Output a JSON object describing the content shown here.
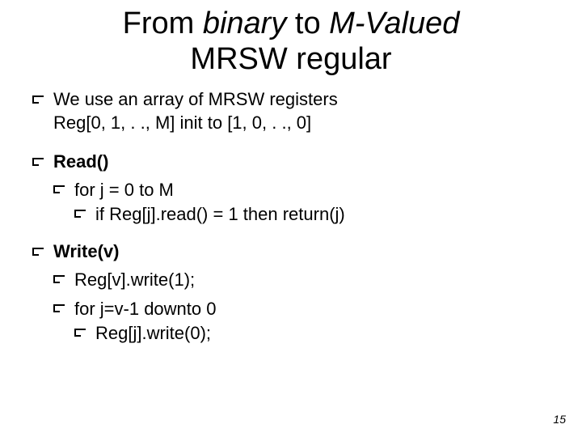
{
  "title": {
    "part1": "From ",
    "part2_ital": "binary",
    "part3": " to ",
    "part4_ital": "M-Valued",
    "line2": "MRSW regular"
  },
  "intro": {
    "line1": "We use an array of MRSW registers",
    "line2": "Reg[0, 1, . ., M] init to [1, 0, . ., 0]"
  },
  "read": {
    "header": "Read()",
    "l1": "for j = 0 to M",
    "l2": "if Reg[j].read() = 1 then return(j)"
  },
  "write": {
    "header": "Write(v)",
    "l1": "Reg[v].write(1);",
    "l2": "for j=v-1 downto 0",
    "l3": "Reg[j].write(0);"
  },
  "page": "15"
}
